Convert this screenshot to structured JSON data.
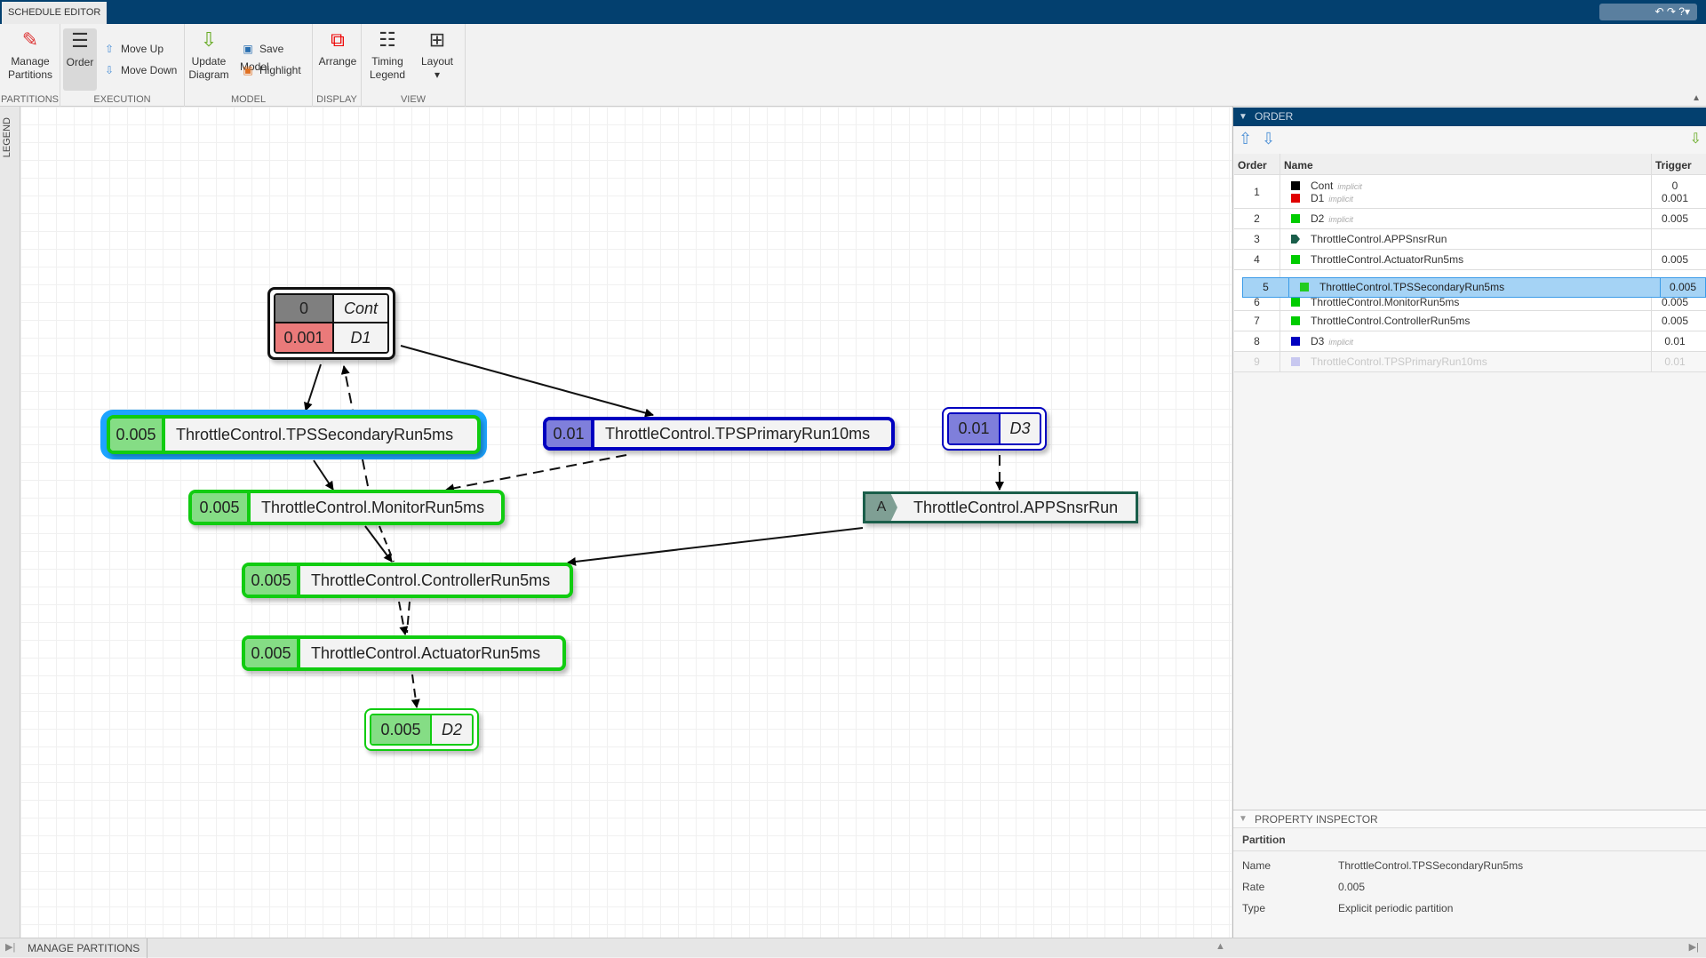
{
  "app": {
    "tab": "SCHEDULE EDITOR"
  },
  "toolstrip": {
    "groups": {
      "partitions": "PARTITIONS",
      "execution": "EXECUTION",
      "model": "MODEL",
      "display": "DISPLAY",
      "view": "VIEW"
    },
    "manage_partitions": "Manage Partitions",
    "order": "Order",
    "move_up": "Move Up",
    "move_down": "Move Down",
    "update_diagram": "Update Diagram",
    "save_model": "Save Model",
    "highlight": "Highlight",
    "arrange": "Arrange",
    "timing_legend": "Timing Legend",
    "layout": "Layout"
  },
  "legend_label": "LEGEND",
  "bottom": {
    "manage_partitions_tab": "MANAGE PARTITIONS"
  },
  "diagram": {
    "cont": {
      "rate": "0",
      "name": "Cont"
    },
    "d1": {
      "rate": "0.001",
      "name": "D1"
    },
    "tps_secondary": {
      "rate": "0.005",
      "name": "ThrottleControl.TPSSecondaryRun5ms"
    },
    "tps_primary": {
      "rate": "0.01",
      "name": "ThrottleControl.TPSPrimaryRun10ms"
    },
    "d3": {
      "rate": "0.01",
      "name": "D3"
    },
    "monitor": {
      "rate": "0.005",
      "name": "ThrottleControl.MonitorRun5ms"
    },
    "appsnsr": {
      "rate": "A",
      "name": "ThrottleControl.APPSnsrRun"
    },
    "controller": {
      "rate": "0.005",
      "name": "ThrottleControl.ControllerRun5ms"
    },
    "actuator": {
      "rate": "0.005",
      "name": "ThrottleControl.ActuatorRun5ms"
    },
    "d2": {
      "rate": "0.005",
      "name": "D2"
    }
  },
  "colors": {
    "black": "#000000",
    "red": "#e00000",
    "green": "#00cc00",
    "blue": "#0000c0",
    "teal": "#1a5e4a",
    "selection": "#1ea4ff"
  },
  "order": {
    "title": "ORDER",
    "columns": [
      "Order",
      "Name",
      "Trigger"
    ],
    "implicit": "implicit",
    "rows": [
      {
        "order": "1",
        "items": [
          {
            "name": "Cont",
            "trigger": "0"
          },
          {
            "name": "D1",
            "trigger": "0.001"
          }
        ]
      },
      {
        "order": "2",
        "name": "D2",
        "trigger": "0.005"
      },
      {
        "order": "3",
        "name": "ThrottleControl.APPSnsrRun",
        "trigger": ""
      },
      {
        "order": "4",
        "name": "ThrottleControl.ActuatorRun5ms",
        "trigger": "0.005"
      },
      {
        "order": "6",
        "name": "ThrottleControl.MonitorRun5ms",
        "trigger": "0.005"
      },
      {
        "order": "7",
        "name": "ThrottleControl.ControllerRun5ms",
        "trigger": "0.005"
      },
      {
        "order": "8",
        "name": "D3",
        "trigger": "0.01"
      },
      {
        "order": "9",
        "name": "ThrottleControl.TPSPrimaryRun10ms",
        "trigger": "0.01"
      }
    ],
    "dragged": {
      "order": "5",
      "name": "ThrottleControl.TPSSecondaryRun5ms",
      "trigger": "0.005"
    }
  },
  "inspector": {
    "title": "PROPERTY INSPECTOR",
    "section": "Partition",
    "name_label": "Name",
    "name": "ThrottleControl.TPSSecondaryRun5ms",
    "rate_label": "Rate",
    "rate": "0.005",
    "type_label": "Type",
    "type": "Explicit periodic partition"
  }
}
